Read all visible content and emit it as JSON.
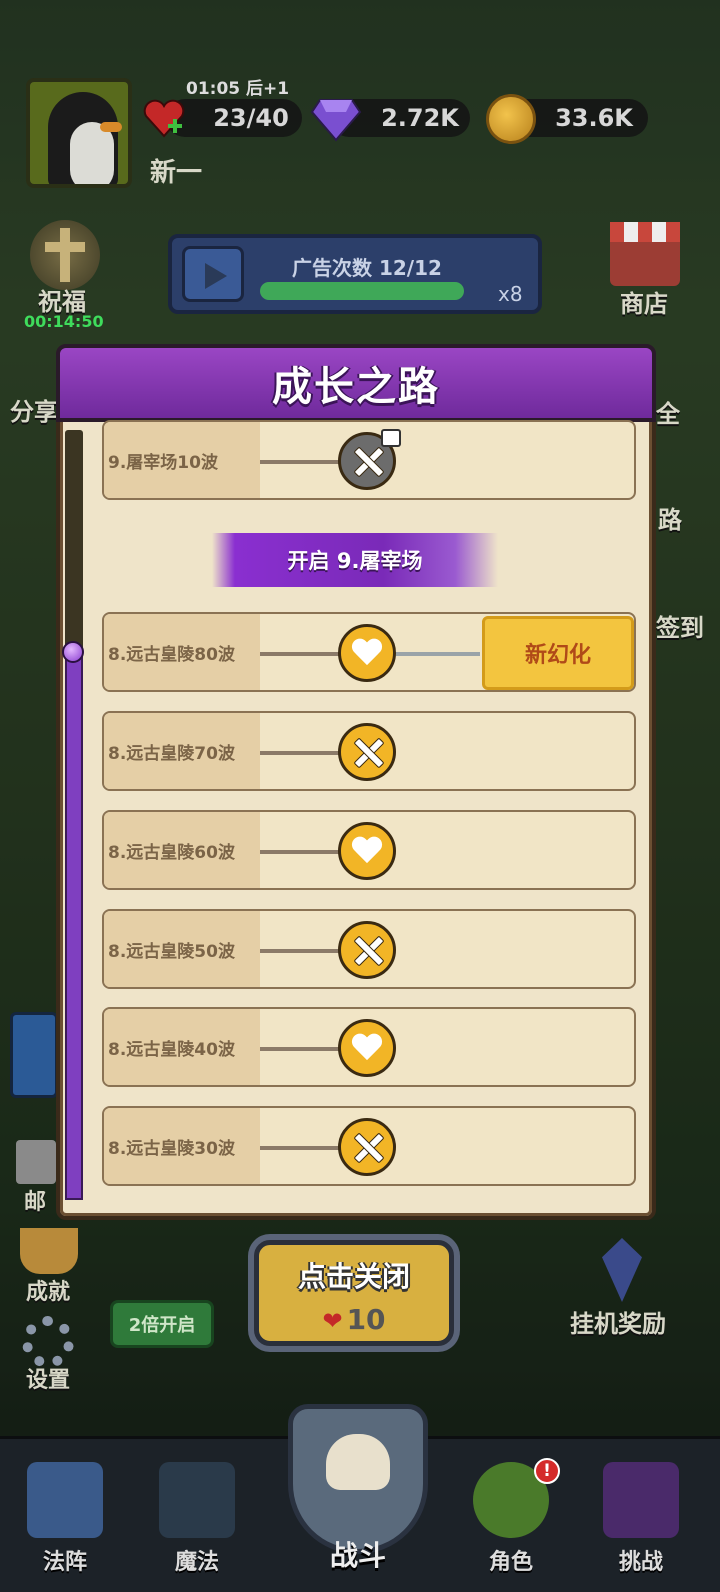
{
  "hud": {
    "player_name": "新一",
    "energy_timer": "01:05 后+1",
    "energy": "23/40",
    "gems": "2.72K",
    "coins": "33.6K"
  },
  "ad": {
    "label": "广告次数 12/12",
    "multiplier": "x8",
    "progress": 1.0
  },
  "side_left": {
    "blessing_label": "祝福",
    "blessing_timer": "00:14:50",
    "share_label": "分享",
    "mail_label": "邮",
    "achievement_label": "成就",
    "settings_label": "设置"
  },
  "side_right": {
    "shop_label": "商店",
    "road_label": "路",
    "signin_label": "签到",
    "idle_reward_label": "挂机奖励",
    "partial_label": "全"
  },
  "panel": {
    "title": "成长之路",
    "unlock_banner": "开启 9.屠宰场",
    "rows": [
      {
        "label": "9.屠宰场10波",
        "reward": "swords",
        "locked": true
      },
      {
        "label": "8.远古皇陵80波",
        "reward": "heart",
        "tag": "新幻化"
      },
      {
        "label": "8.远古皇陵70波",
        "reward": "swords"
      },
      {
        "label": "8.远古皇陵60波",
        "reward": "heart"
      },
      {
        "label": "8.远古皇陵50波",
        "reward": "swords"
      },
      {
        "label": "8.远古皇陵40波",
        "reward": "heart"
      },
      {
        "label": "8.远古皇陵30波",
        "reward": "swords"
      }
    ]
  },
  "close_button": {
    "label": "点击关闭",
    "cost": "10"
  },
  "double_button": "2倍开启",
  "nav": {
    "formation": "法阵",
    "magic": "魔法",
    "battle": "战斗",
    "character": "角色",
    "challenge": "挑战",
    "alert": "!"
  },
  "colors": {
    "panel_header": "#8a3dc0",
    "panel_bg": "#efe4c9",
    "reward_gold": "#f2b526",
    "progress_purple": "#7f3fc0"
  }
}
